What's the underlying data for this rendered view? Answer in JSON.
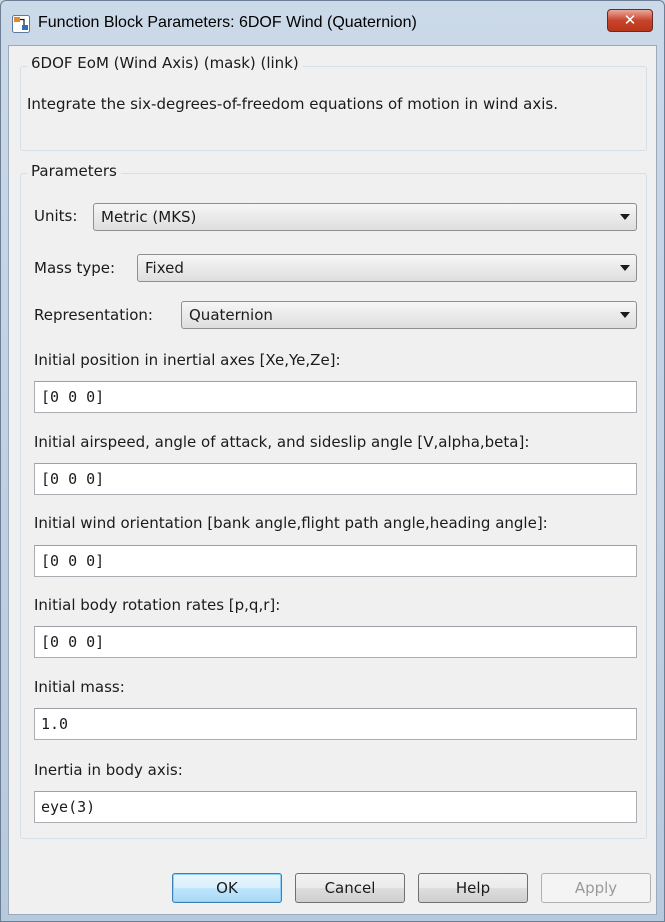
{
  "window": {
    "title": "Function Block Parameters: 6DOF Wind (Quaternion)",
    "close_label": "✕",
    "app_icon": "simulink-block-icon"
  },
  "block": {
    "group_title": "6DOF EoM (Wind Axis) (mask) (link)",
    "description": "Integrate the six-degrees-of-freedom equations of motion in wind axis."
  },
  "parameters": {
    "group_title": "Parameters",
    "units": {
      "label": "Units:",
      "value": "Metric (MKS)"
    },
    "mass_type": {
      "label": "Mass type:",
      "value": "Fixed"
    },
    "representation": {
      "label": "Representation:",
      "value": "Quaternion"
    },
    "fields": [
      {
        "label": "Initial position in inertial axes [Xe,Ye,Ze]:",
        "value": "[0 0 0]"
      },
      {
        "label": "Initial airspeed, angle of attack, and sideslip angle [V,alpha,beta]:",
        "value": "[0 0 0]"
      },
      {
        "label": "Initial wind orientation [bank angle,flight path angle,heading angle]:",
        "value": "[0 0 0]"
      },
      {
        "label": "Initial body rotation rates [p,q,r]:",
        "value": "[0 0 0]"
      },
      {
        "label": "Initial mass:",
        "value": "1.0"
      },
      {
        "label": "Inertia in body axis:",
        "value": "eye(3)"
      }
    ]
  },
  "buttons": {
    "ok": "OK",
    "cancel": "Cancel",
    "help": "Help",
    "apply": "Apply"
  },
  "colors": {
    "title_bar": "#c2d3e6",
    "close_button": "#c8442c",
    "dialog_background": "#f0f0f0",
    "default_button": "#a7d9f5"
  }
}
